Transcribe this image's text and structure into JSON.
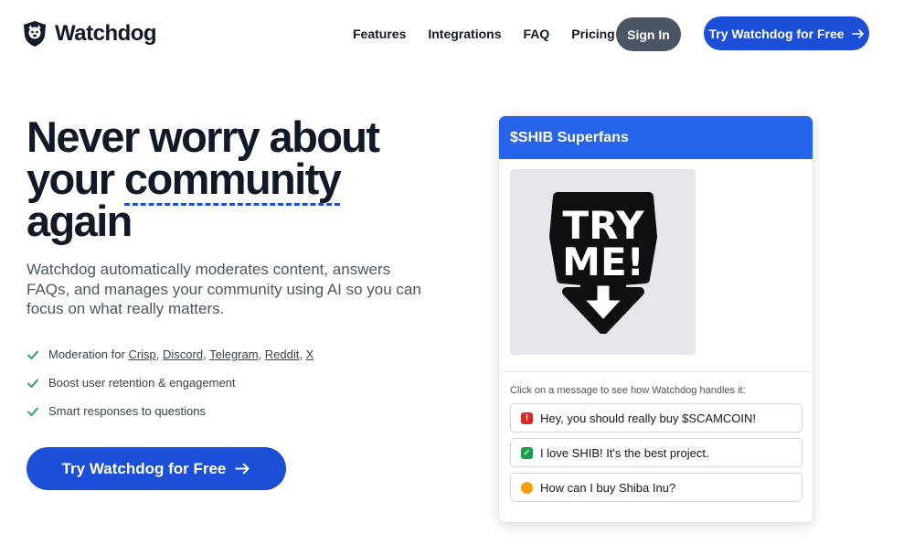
{
  "brand": {
    "name": "Watchdog"
  },
  "nav": {
    "items": [
      "Features",
      "Integrations",
      "FAQ",
      "Pricing"
    ],
    "sign_in": "Sign In",
    "try_free": "Try Watchdog for Free"
  },
  "hero": {
    "headline_line1": "Never worry about",
    "headline_line2a": "your ",
    "headline_line2b": "community",
    "headline_line3": "again",
    "subtext": "Watchdog automatically moderates content, answers FAQs, and manages your community using AI so you can focus on what really matters.",
    "features": {
      "moderation_prefix": "Moderation for ",
      "platforms": [
        "Crisp",
        "Discord",
        "Telegram",
        "Reddit",
        "X"
      ],
      "retention": "Boost user retention & engagement",
      "responses": "Smart responses to questions"
    },
    "cta": "Try Watchdog for Free"
  },
  "demo": {
    "group_title": "$SHIB Superfans",
    "sticker_text_line1": "TRY",
    "sticker_text_line2": "ME!",
    "hint": "Click on a message to see how Watchdog handles it:",
    "messages": [
      {
        "icon": "alarm-icon",
        "text": "Hey, you should really buy $SCAMCOIN!"
      },
      {
        "icon": "check-mark-icon",
        "text": "I love SHIB! It's the best project."
      },
      {
        "icon": "raising-hand-icon",
        "text": "How can I buy Shiba Inu?"
      }
    ]
  },
  "colors": {
    "primary": "#1d4ed8",
    "card_header": "#2563eb",
    "check": "#16a34a",
    "sign_in_bg": "#4b5563"
  }
}
